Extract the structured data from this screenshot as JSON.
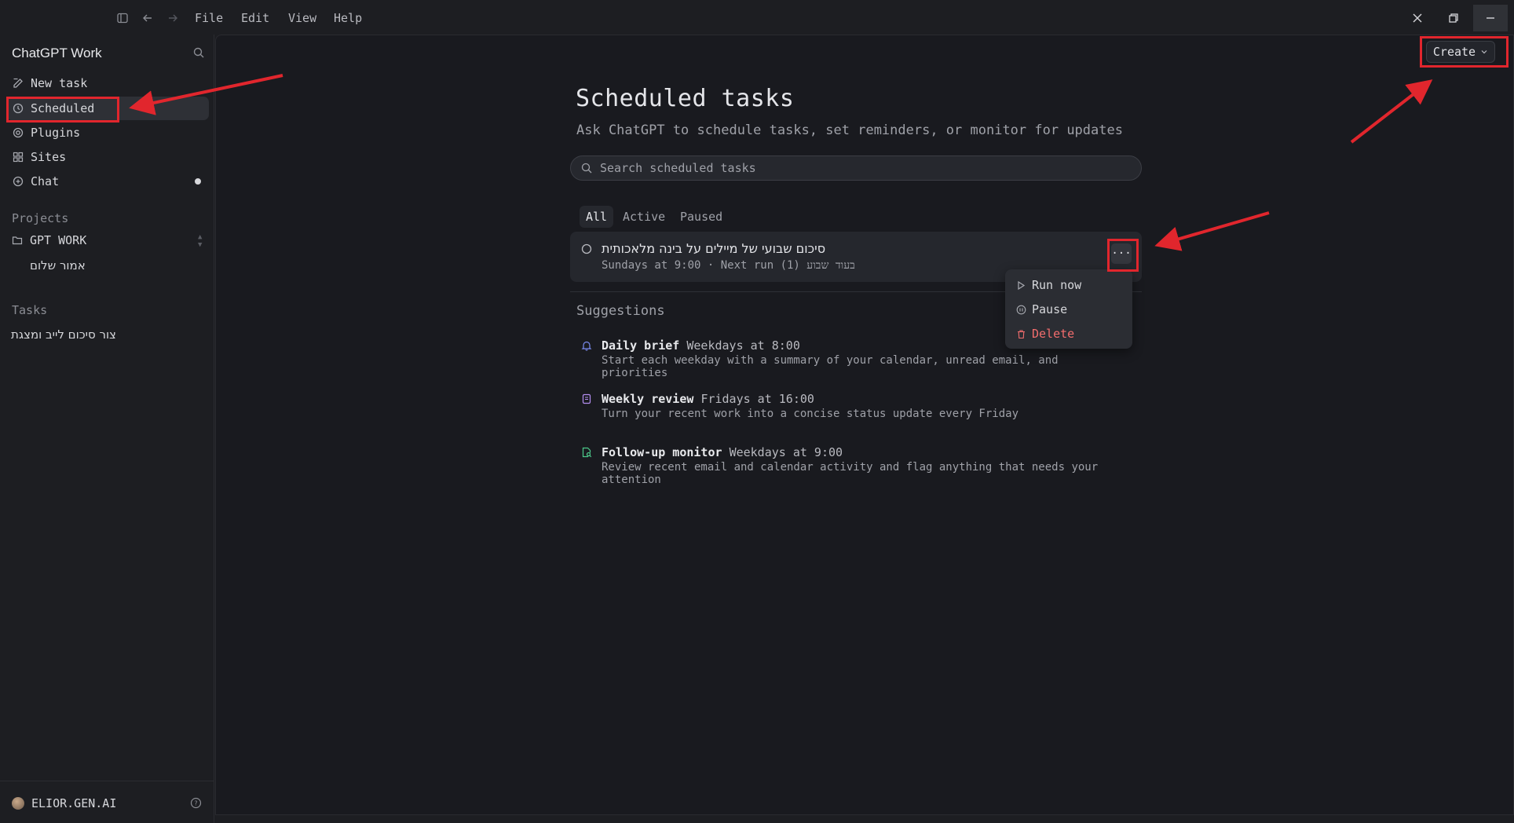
{
  "topbar": {
    "menus": [
      "File",
      "Edit",
      "View",
      "Help"
    ]
  },
  "sidebar": {
    "brand": "ChatGPT Work",
    "nav": [
      {
        "label": "New task",
        "icon": "edit-icon"
      },
      {
        "label": "Scheduled",
        "icon": "clock-icon",
        "active": true
      },
      {
        "label": "Plugins",
        "icon": "at-icon"
      },
      {
        "label": "Sites",
        "icon": "grid-icon"
      },
      {
        "label": "Chat",
        "icon": "chat-plus-icon"
      }
    ],
    "projects_label": "Projects",
    "projects": [
      {
        "label": "GPT WORK",
        "icon": "folder-icon"
      },
      {
        "label": "אמור שלום"
      }
    ],
    "tasks_label": "Tasks",
    "tasks": [
      "צור סיכום לייב ומצגת"
    ],
    "user": {
      "name": "ELIOR.GEN.AI"
    }
  },
  "main": {
    "create_label": "Create",
    "title": "Scheduled tasks",
    "subtitle": "Ask ChatGPT to schedule tasks, set reminders, or monitor for updates",
    "search_placeholder": "Search scheduled tasks",
    "tabs": [
      {
        "label": "All",
        "active": true
      },
      {
        "label": "Active"
      },
      {
        "label": "Paused"
      }
    ],
    "task": {
      "title": "סיכום שבועי של מיילים על בינה מלאכותית",
      "meta": "Sundays at 9:00 · Next run (1) בעוד שבוע"
    },
    "menu": {
      "run_now": "Run now",
      "pause": "Pause",
      "delete": "Delete"
    },
    "suggestions_label": "Suggestions",
    "suggestions": [
      {
        "title": "Daily brief",
        "time": "Weekdays at 8:00",
        "desc": "Start each weekday with a summary of your calendar, unread email, and priorities",
        "icon": "bell-icon",
        "color": "#7b8cf0"
      },
      {
        "title": "Weekly review",
        "time": "Fridays at 16:00",
        "desc": "Turn your recent work into a concise status update every Friday",
        "icon": "document-icon",
        "color": "#b48ef0"
      },
      {
        "title": "Follow-up monitor",
        "time": "Weekdays at 9:00",
        "desc": "Review recent email and calendar activity and flag anything that needs your attention",
        "icon": "search-doc-icon",
        "color": "#4cc98a"
      }
    ]
  },
  "colors": {
    "annotation": "#e1262d",
    "danger": "#f26d6d"
  }
}
